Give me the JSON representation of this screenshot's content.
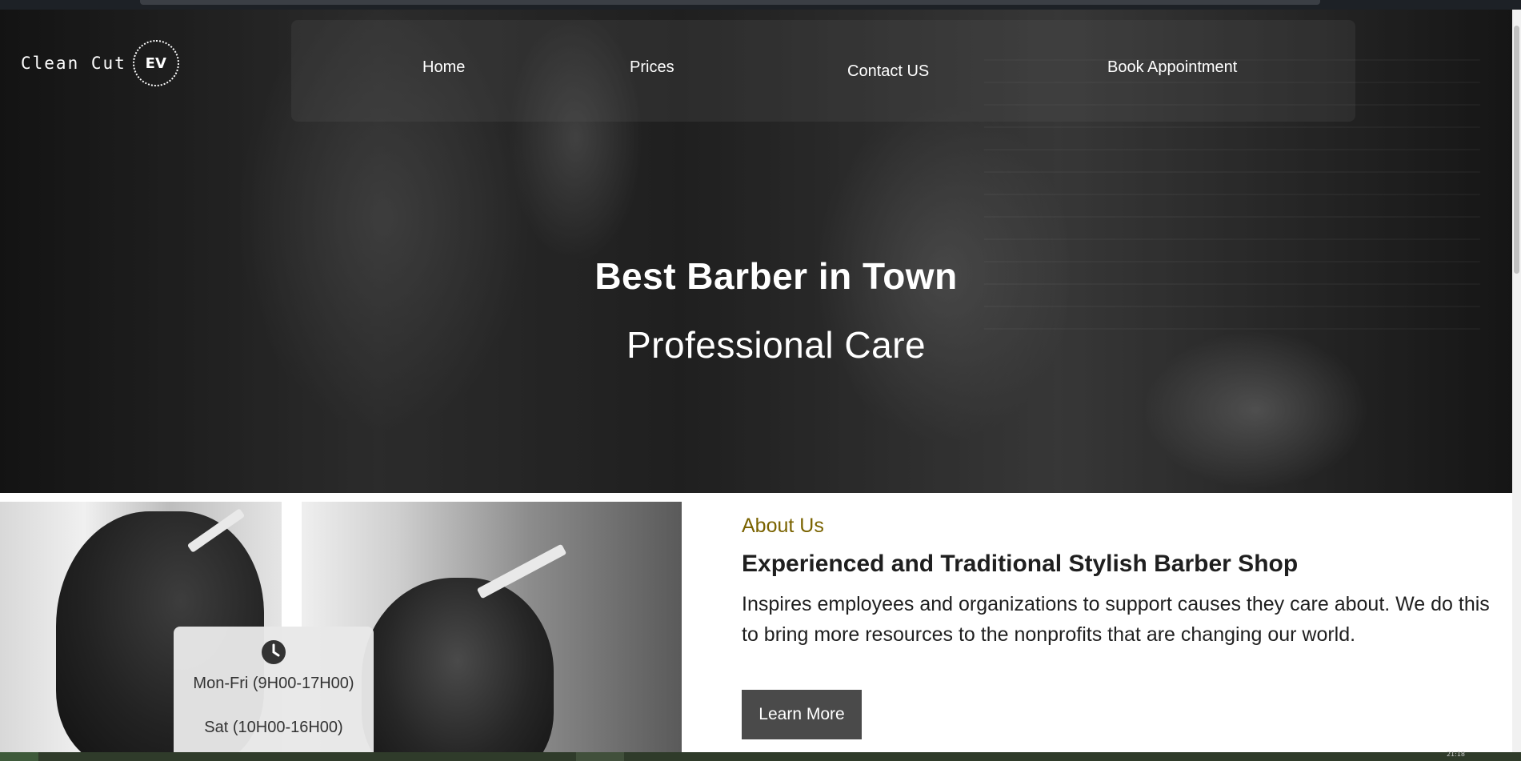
{
  "brand": {
    "name": "Clean Cut",
    "logo_text": "EV"
  },
  "nav": {
    "items": [
      {
        "label": "Home"
      },
      {
        "label": "Prices"
      },
      {
        "label": "Contact US"
      },
      {
        "label": "Book Appointment"
      }
    ]
  },
  "hero": {
    "title_line1": "Best Barber in Town",
    "title_line2": "Professional Care"
  },
  "hours": {
    "icon": "clock-icon",
    "weekday": "Mon-Fri (9H00-17H00)",
    "saturday": "Sat (10H00-16H00)"
  },
  "about": {
    "eyebrow": "About Us",
    "heading": "Experienced and Traditional Stylish Barber Shop",
    "body": "Inspires employees and organizations to support causes they care about. We do this to bring more resources to the nonprofits that are changing our world.",
    "button_label": "Learn More"
  },
  "taskbar": {
    "clock": "21:18"
  },
  "colors": {
    "accent_gold": "#7a6300",
    "button_bg": "#4a4a4a",
    "text_dark": "#1f1f1f"
  }
}
